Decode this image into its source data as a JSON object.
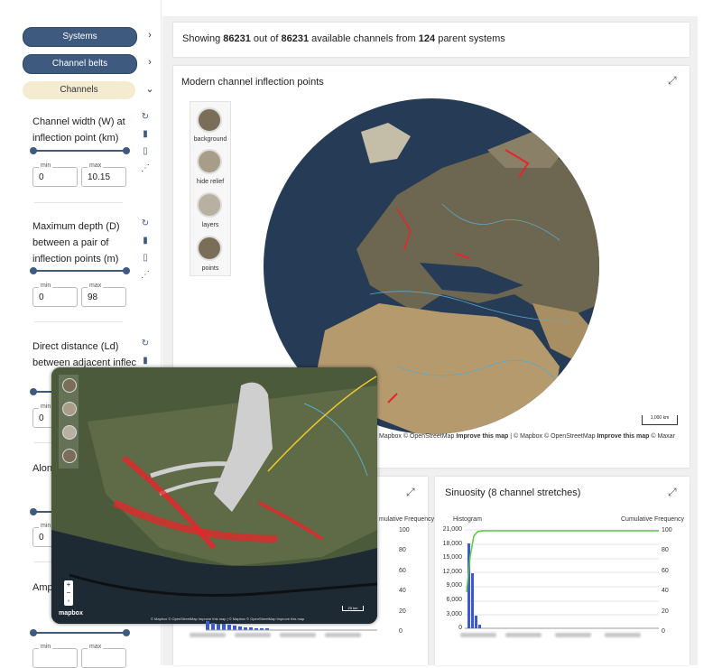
{
  "sidebar": {
    "nav": [
      {
        "label": "Systems"
      },
      {
        "label": "Channel belts"
      },
      {
        "label": "Channels"
      }
    ],
    "filters": [
      {
        "label": "Channel width (W) at inflection point (km)",
        "min_label": "min",
        "max_label": "max",
        "min": "0",
        "max": "10.15"
      },
      {
        "label": "Maximum depth (D) between a pair of inflection points (m)",
        "min_label": "min",
        "max_label": "max",
        "min": "0",
        "max": "98"
      },
      {
        "label": "Direct distance (Ld) between adjacent inflec",
        "min_label": "min",
        "max_label": "max",
        "min": "0",
        "max": ""
      },
      {
        "label": "Along (Lc) inflec",
        "min_label": "min",
        "max_label": "max",
        "min": "0",
        "max": ""
      },
      {
        "label": "Amp adjac point",
        "min_label": "min",
        "max_label": "max",
        "min": "",
        "max": ""
      }
    ]
  },
  "status": {
    "prefix": "Showing ",
    "shown": "86231",
    "mid": " out of ",
    "total": "86231",
    "mid2": " available channels from ",
    "parents": "124",
    "suffix": " parent systems"
  },
  "map_card": {
    "title": "Modern channel inflection points",
    "tools": [
      {
        "label": "background",
        "icon": "background-icon"
      },
      {
        "label": "hide relief",
        "icon": "hide-relief-icon"
      },
      {
        "label": "layers",
        "icon": "layers-icon"
      },
      {
        "label": "points",
        "icon": "points-icon"
      }
    ],
    "attribution_left": "Mapbox © OpenStreetMap",
    "improve_left": "Improve this map",
    "attribution_right": "| © Mapbox © OpenStreetMap",
    "improve_right": "Improve this map",
    "maxar": "© Maxar",
    "scale": "1,000 km"
  },
  "inset": {
    "tools": [
      "background",
      "hide relief",
      "layers",
      "points"
    ],
    "logo": "mapbox",
    "scale": "20 km",
    "attribution": "© Mapbox © OpenStreetMap Improve this map | © Mapbox © OpenStreetMap Improve this map"
  },
  "hist_left": {
    "legend_right": "mulative Frequency",
    "right_ticks": [
      "100",
      "80",
      "60",
      "40",
      "20",
      "0"
    ]
  },
  "sinuosity": {
    "title": "Sinuosity (8 channel stretches)",
    "legend_left": "Histogram",
    "legend_right": "Cumulative Frequency",
    "left_ticks": [
      "21,000",
      "18,000",
      "15,000",
      "12,000",
      "9,000",
      "6,000",
      "3,000",
      "0"
    ],
    "right_ticks": [
      "100",
      "80",
      "60",
      "40",
      "20",
      "0"
    ]
  },
  "colors": {
    "accent": "#3e5a7e",
    "beige": "#f4ebd0",
    "hist": "#3b5cc4",
    "cum": "#5cc84a",
    "points": "#e8242a"
  }
}
